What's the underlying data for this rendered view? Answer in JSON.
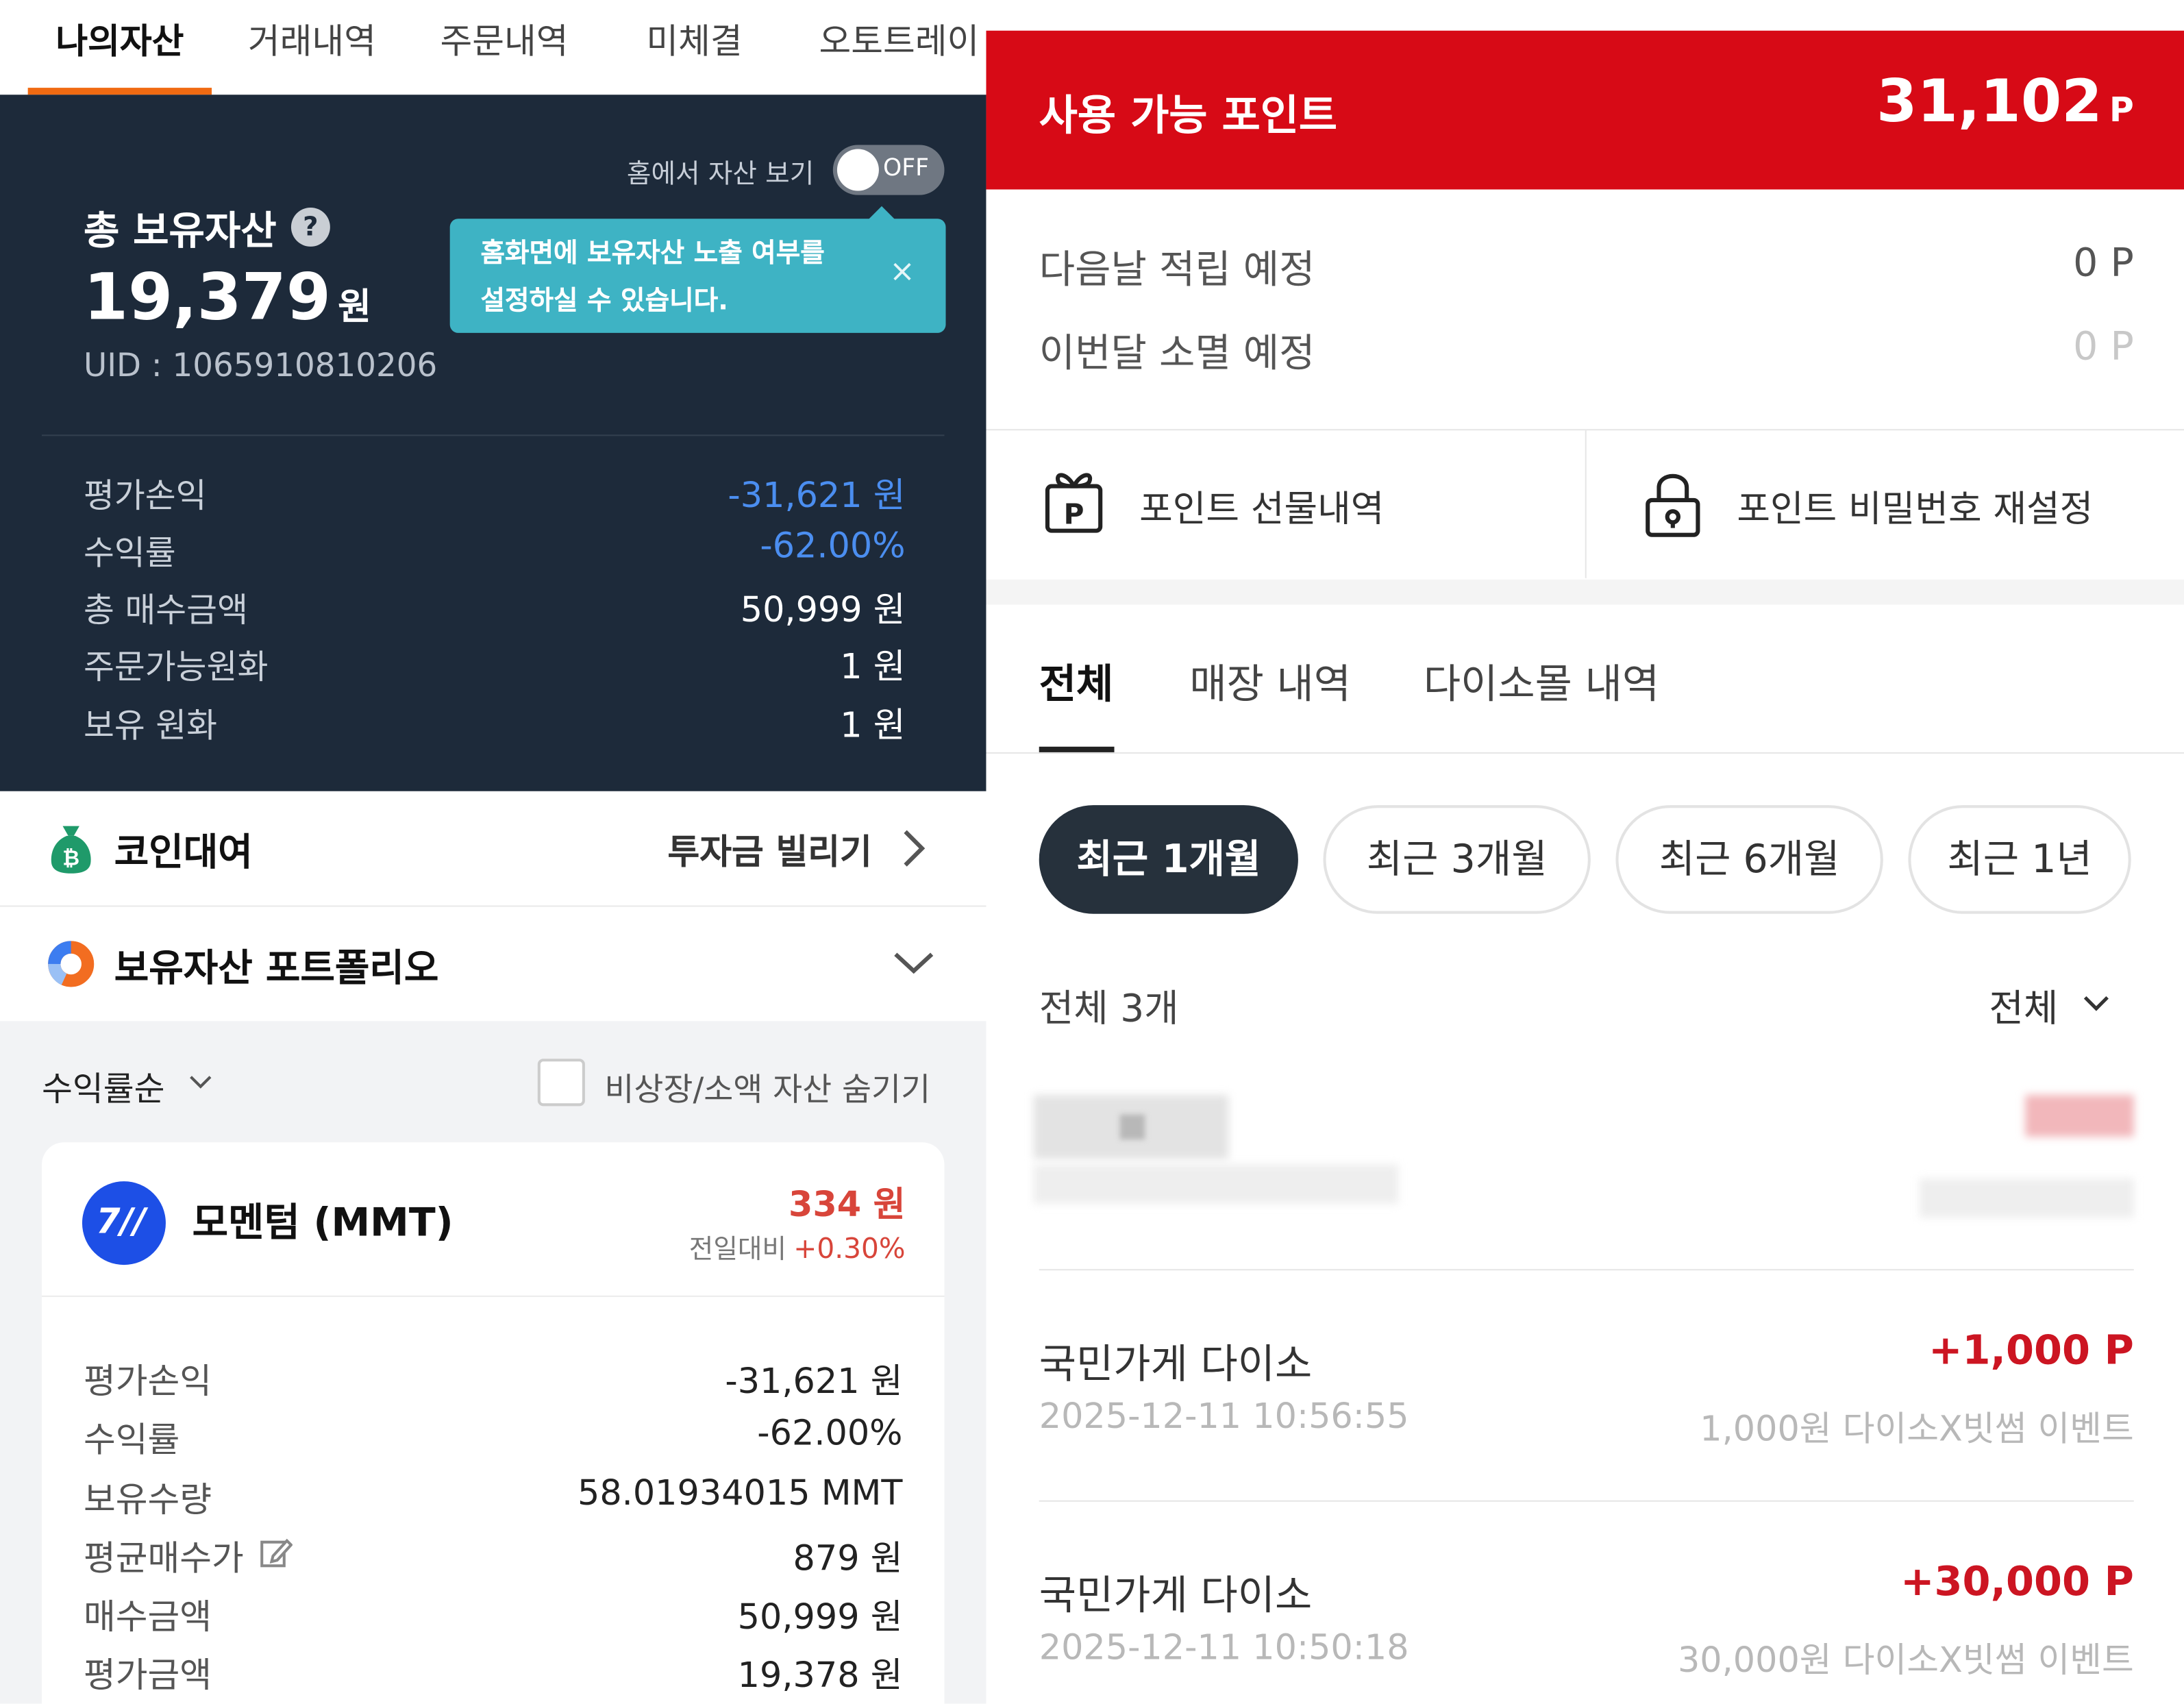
{
  "left": {
    "tabs": [
      "나의자산",
      "거래내역",
      "주문내역",
      "미체결",
      "오토트레이"
    ],
    "home_asset_toggle": {
      "label": "홈에서 자산 보기",
      "state": "OFF"
    },
    "tooltip": {
      "line1": "홈화면에 보유자산 노출 여부를",
      "line2": "설정하실 수 있습니다.",
      "close": "×"
    },
    "total": {
      "title": "총 보유자산",
      "help": "?",
      "amount": "19,379",
      "unit": "원",
      "uid": "UID : 1065910810206"
    },
    "summary": [
      {
        "label": "평가손익",
        "value": "-31,621 원"
      },
      {
        "label": "수익률",
        "value": "-62.00%"
      },
      {
        "label": "총 매수금액",
        "value": "50,999 원"
      },
      {
        "label": "주문가능원화",
        "value": "1 원"
      },
      {
        "label": "보유 원화",
        "value": "1 원"
      }
    ],
    "coin_lending": {
      "title": "코인대여",
      "link": "투자금 빌리기"
    },
    "portfolio": {
      "title": "보유자산 포트폴리오"
    },
    "filters": {
      "sort": "수익률순",
      "hide_label": "비상장/소액 자산 숨기기"
    },
    "asset": {
      "name": "모멘텀 (MMT)",
      "price": "334 원",
      "change_label": "전일대비",
      "change": "+0.30%",
      "rows": [
        {
          "label": "평가손익",
          "value": "-31,621 원"
        },
        {
          "label": "수익률",
          "value": "-62.00%"
        },
        {
          "label": "보유수량",
          "value": "58.01934015 MMT"
        },
        {
          "label": "평균매수가",
          "value": "879 원"
        },
        {
          "label": "매수금액",
          "value": "50,999 원"
        },
        {
          "label": "평가금액",
          "value": "19,378 원"
        }
      ]
    }
  },
  "right": {
    "available": {
      "label": "사용 가능 포인트",
      "value": "31,102",
      "unit": "P"
    },
    "expected": [
      {
        "label": "다음날 적립 예정",
        "value": "0 P"
      },
      {
        "label": "이번달 소멸 예정",
        "value": "0 P"
      }
    ],
    "actions": [
      {
        "label": "포인트 선물내역",
        "icon": "gift-icon"
      },
      {
        "label": "포인트 비밀번호 재설정",
        "icon": "lock-icon"
      }
    ],
    "tabs": [
      "전체",
      "매장 내역",
      "다이소몰 내역"
    ],
    "periods": [
      "최근 1개월",
      "최근 3개월",
      "최근 6개월",
      "최근 1년"
    ],
    "count_label": "전체 3개",
    "filter": "전체",
    "transactions": [
      {
        "store": "국민가게 다이소",
        "time": "2025-12-11 10:56:55",
        "points": "+1,000 P",
        "desc": "1,000원 다이소X빗썸 이벤트"
      },
      {
        "store": "국민가게 다이소",
        "time": "2025-12-11 10:50:18",
        "points": "+30,000 P",
        "desc": "30,000원 다이소X빗썸 이벤트"
      }
    ]
  },
  "colors": {
    "accent_orange": "#f06a12",
    "dark_panel": "#1d2a3a",
    "point_red": "#d70a16",
    "loss_blue": "#4b8ef0",
    "gain_red": "#d8453a",
    "tooltip_teal": "#3eb3c4"
  }
}
